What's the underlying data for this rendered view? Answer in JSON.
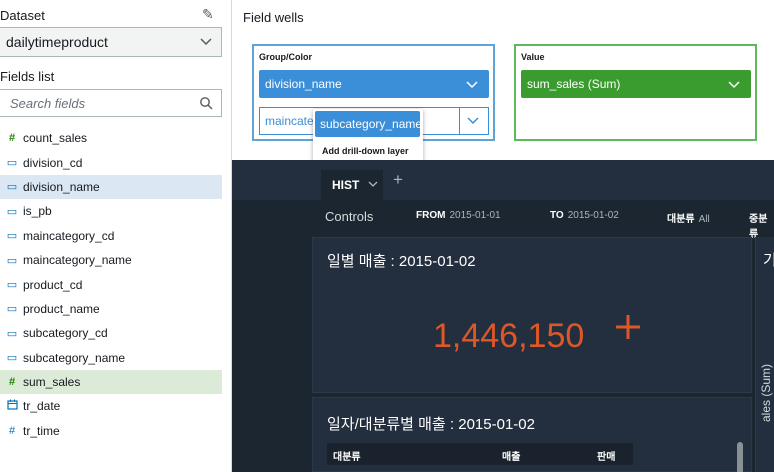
{
  "sidebar": {
    "dataset_label": "Dataset",
    "dataset_value": "dailytimeproduct",
    "fields_label": "Fields list",
    "search_placeholder": "Search fields",
    "fields": [
      {
        "name": "count_sales",
        "type": "measure"
      },
      {
        "name": "division_cd",
        "type": "dimension"
      },
      {
        "name": "division_name",
        "type": "dimension"
      },
      {
        "name": "is_pb",
        "type": "dimension"
      },
      {
        "name": "maincategory_cd",
        "type": "dimension"
      },
      {
        "name": "maincategory_name",
        "type": "dimension"
      },
      {
        "name": "product_cd",
        "type": "dimension"
      },
      {
        "name": "product_name",
        "type": "dimension"
      },
      {
        "name": "subcategory_cd",
        "type": "dimension"
      },
      {
        "name": "subcategory_name",
        "type": "dimension"
      },
      {
        "name": "sum_sales",
        "type": "measure"
      },
      {
        "name": "tr_date",
        "type": "date"
      },
      {
        "name": "tr_time",
        "type": "measure"
      }
    ]
  },
  "field_wells": {
    "title": "Field wells",
    "group": {
      "label": "Group/Color",
      "field1": "division_name",
      "field2": "maincateg"
    },
    "value": {
      "label": "Value",
      "field1": "sum_sales (Sum)"
    },
    "drag": {
      "chip": "subcategory_name",
      "action": "Add drill-down layer"
    }
  },
  "dashboard": {
    "tab": "HIST",
    "controls": {
      "label": "Controls",
      "from_key": "FROM",
      "from_val": "2015-01-01",
      "to_key": "TO",
      "to_val": "2015-01-02",
      "cat_key": "대분류",
      "cat_val": "All",
      "sub_key": "중분류"
    },
    "visual1": {
      "title": "일별 매출 : 2015-01-02",
      "kpi": "1,446,150"
    },
    "visual2": {
      "title": "일자/대분류별 매출 : 2015-01-02",
      "col1": "대분류",
      "col2": "매출",
      "col3": "판매"
    },
    "right": {
      "title": "기",
      "vertical": "ales (Sum)"
    }
  },
  "colors": {
    "accent_blue": "#3b8ed8",
    "accent_green": "#3a9c2f",
    "kpi": "#dd5727",
    "dark_bg": "#1c2630"
  }
}
